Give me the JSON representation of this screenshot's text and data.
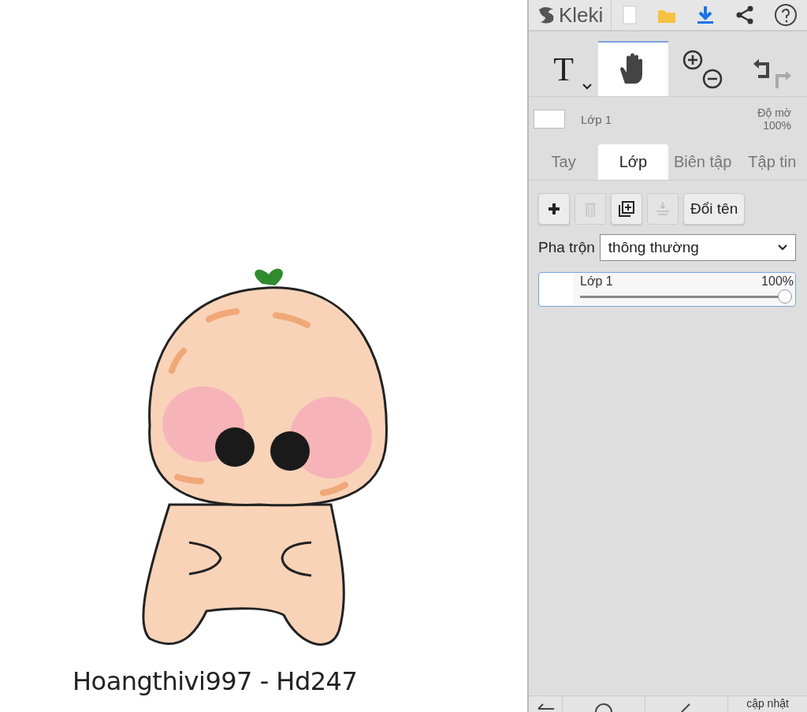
{
  "canvas": {
    "signature": "Hoangthivi997 - Hd247"
  },
  "header": {
    "logo": "Kleki"
  },
  "tools": [
    {
      "kind": "text",
      "label": "T",
      "selected": false
    },
    {
      "kind": "hand",
      "selected": true
    },
    {
      "kind": "zoom",
      "selected": false
    },
    {
      "kind": "history",
      "redo_disabled": true,
      "selected": false
    }
  ],
  "layer_preview": {
    "name": "Lớp 1",
    "opacity_label": "Độ mờ",
    "opacity": "100%"
  },
  "tabs": [
    {
      "label": "Tay",
      "selected": false
    },
    {
      "label": "Lớp",
      "selected": true
    },
    {
      "label": "Biên tập",
      "selected": false
    },
    {
      "label": "Tập tin",
      "selected": false
    }
  ],
  "layer_buttons": [
    {
      "kind": "add",
      "disabled": false
    },
    {
      "kind": "delete",
      "disabled": true
    },
    {
      "kind": "duplicate",
      "disabled": false
    },
    {
      "kind": "merge",
      "disabled": true
    },
    {
      "kind": "rename",
      "label": "Đổi tên",
      "disabled": false
    }
  ],
  "blend": {
    "label": "Pha trộn",
    "value": "thông thường"
  },
  "layers": [
    {
      "name": "Lớp 1",
      "opacity": "100%",
      "level": 1,
      "selected": true
    }
  ],
  "bottom_bar": {
    "update": "cập nhật"
  }
}
